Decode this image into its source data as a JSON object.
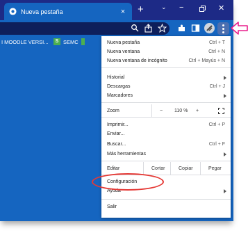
{
  "browser": {
    "tab_title": "Nueva pestaña",
    "tab_close": "×",
    "new_tab": "+"
  },
  "bookmarks": [
    {
      "label": "I MOODLE VERSI..."
    },
    {
      "icon_text": "S",
      "label": "SEMC"
    }
  ],
  "menu": {
    "items": [
      {
        "label": "Nueva pestaña",
        "shortcut": "Ctrl + T"
      },
      {
        "label": "Nueva ventana",
        "shortcut": "Ctrl + N"
      },
      {
        "label": "Nueva ventana de incógnito",
        "shortcut": "Ctrl + Mayús + N"
      },
      {
        "label": "Historial",
        "submenu": true
      },
      {
        "label": "Descargas",
        "shortcut": "Ctrl + J"
      },
      {
        "label": "Marcadores",
        "submenu": true
      },
      {
        "label": "Imprimir...",
        "shortcut": "Ctrl + P"
      },
      {
        "label": "Enviar..."
      },
      {
        "label": "Buscar...",
        "shortcut": "Ctrl + F"
      },
      {
        "label": "Más herramientas",
        "submenu": true
      },
      {
        "label": "Configuración"
      },
      {
        "label": "Ayuda",
        "submenu": true
      },
      {
        "label": "Salir"
      }
    ],
    "zoom": {
      "label": "Zoom",
      "minus": "−",
      "value": "110 %",
      "plus": "+"
    },
    "edit": {
      "label": "Editar",
      "cut": "Cortar",
      "copy": "Copiar",
      "paste": "Pegar"
    }
  }
}
